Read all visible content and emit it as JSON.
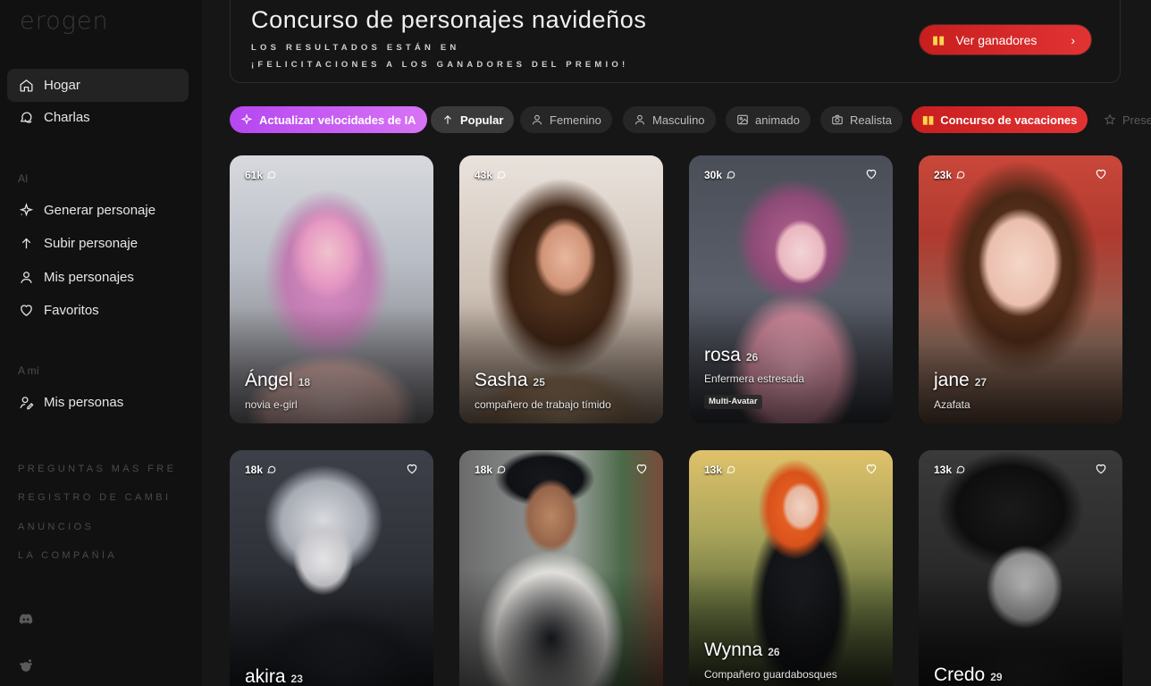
{
  "sidebar": {
    "logo": "erogen",
    "nav_main": [
      {
        "label": "Hogar",
        "icon": "home-icon"
      },
      {
        "label": "Charlas",
        "icon": "chat-icon"
      }
    ],
    "section_ai": "AI",
    "nav_ai": [
      {
        "label": "Generar personaje",
        "icon": "sparkle-icon"
      },
      {
        "label": "Subir personaje",
        "icon": "upload-icon"
      },
      {
        "label": "Mis personajes",
        "icon": "user-icon"
      },
      {
        "label": "Favoritos",
        "icon": "heart-icon"
      }
    ],
    "section_me": "A mí",
    "nav_me": [
      {
        "label": "Mis personas",
        "icon": "persona-icon"
      }
    ],
    "footer_links": [
      "PREGUNTAS MÁS FRE",
      "REGISTRO DE CAMBI",
      "ANUNCIOS",
      "LA COMPAÑÍA"
    ],
    "social_icons": [
      "discord-icon",
      "reddit-icon"
    ]
  },
  "banner": {
    "title": "Concurso de personajes navideños",
    "subtitle_line1": "LOS RESULTADOS ESTÁN EN",
    "subtitle_line2": "¡FELICITACIONES A LOS GANADORES DEL PREMIO!",
    "button_label": "Ver ganadores",
    "accent_color": "#d92525"
  },
  "filters": [
    {
      "label": "Actualizar velocidades de IA",
      "icon": "sparkle-icon",
      "style": "ai"
    },
    {
      "label": "Popular",
      "icon": "arrow-up-icon",
      "style": "popular"
    },
    {
      "label": "Femenino",
      "icon": "user-icon",
      "style": "default"
    },
    {
      "label": "Masculino",
      "icon": "user-icon",
      "style": "default"
    },
    {
      "label": "animado",
      "icon": "image-icon",
      "style": "default"
    },
    {
      "label": "Realista",
      "icon": "camera-icon",
      "style": "default"
    },
    {
      "label": "Concurso de vacaciones",
      "icon": "gift-icon",
      "style": "vacation"
    },
    {
      "label": "Prese",
      "icon": "star-icon",
      "style": "ghost"
    }
  ],
  "cards": [
    {
      "count": "61k",
      "name": "Ángel",
      "age": "18",
      "description": "novia e-girl"
    },
    {
      "count": "43k",
      "name": "Sasha",
      "age": "25",
      "description": "compañero de trabajo tímido"
    },
    {
      "count": "30k",
      "name": "rosa",
      "age": "26",
      "description": "Enfermera estresada",
      "tag": "Multi-Avatar"
    },
    {
      "count": "23k",
      "name": "jane",
      "age": "27",
      "description": "Azafata"
    },
    {
      "count": "18k",
      "name": "akira",
      "age": "23",
      "description": ""
    },
    {
      "count": "18k",
      "name": "",
      "age": "",
      "description": ""
    },
    {
      "count": "13k",
      "name": "Wynna",
      "age": "26",
      "description": "Compañero guardabosques"
    },
    {
      "count": "13k",
      "name": "Credo",
      "age": "29",
      "description": ""
    }
  ]
}
